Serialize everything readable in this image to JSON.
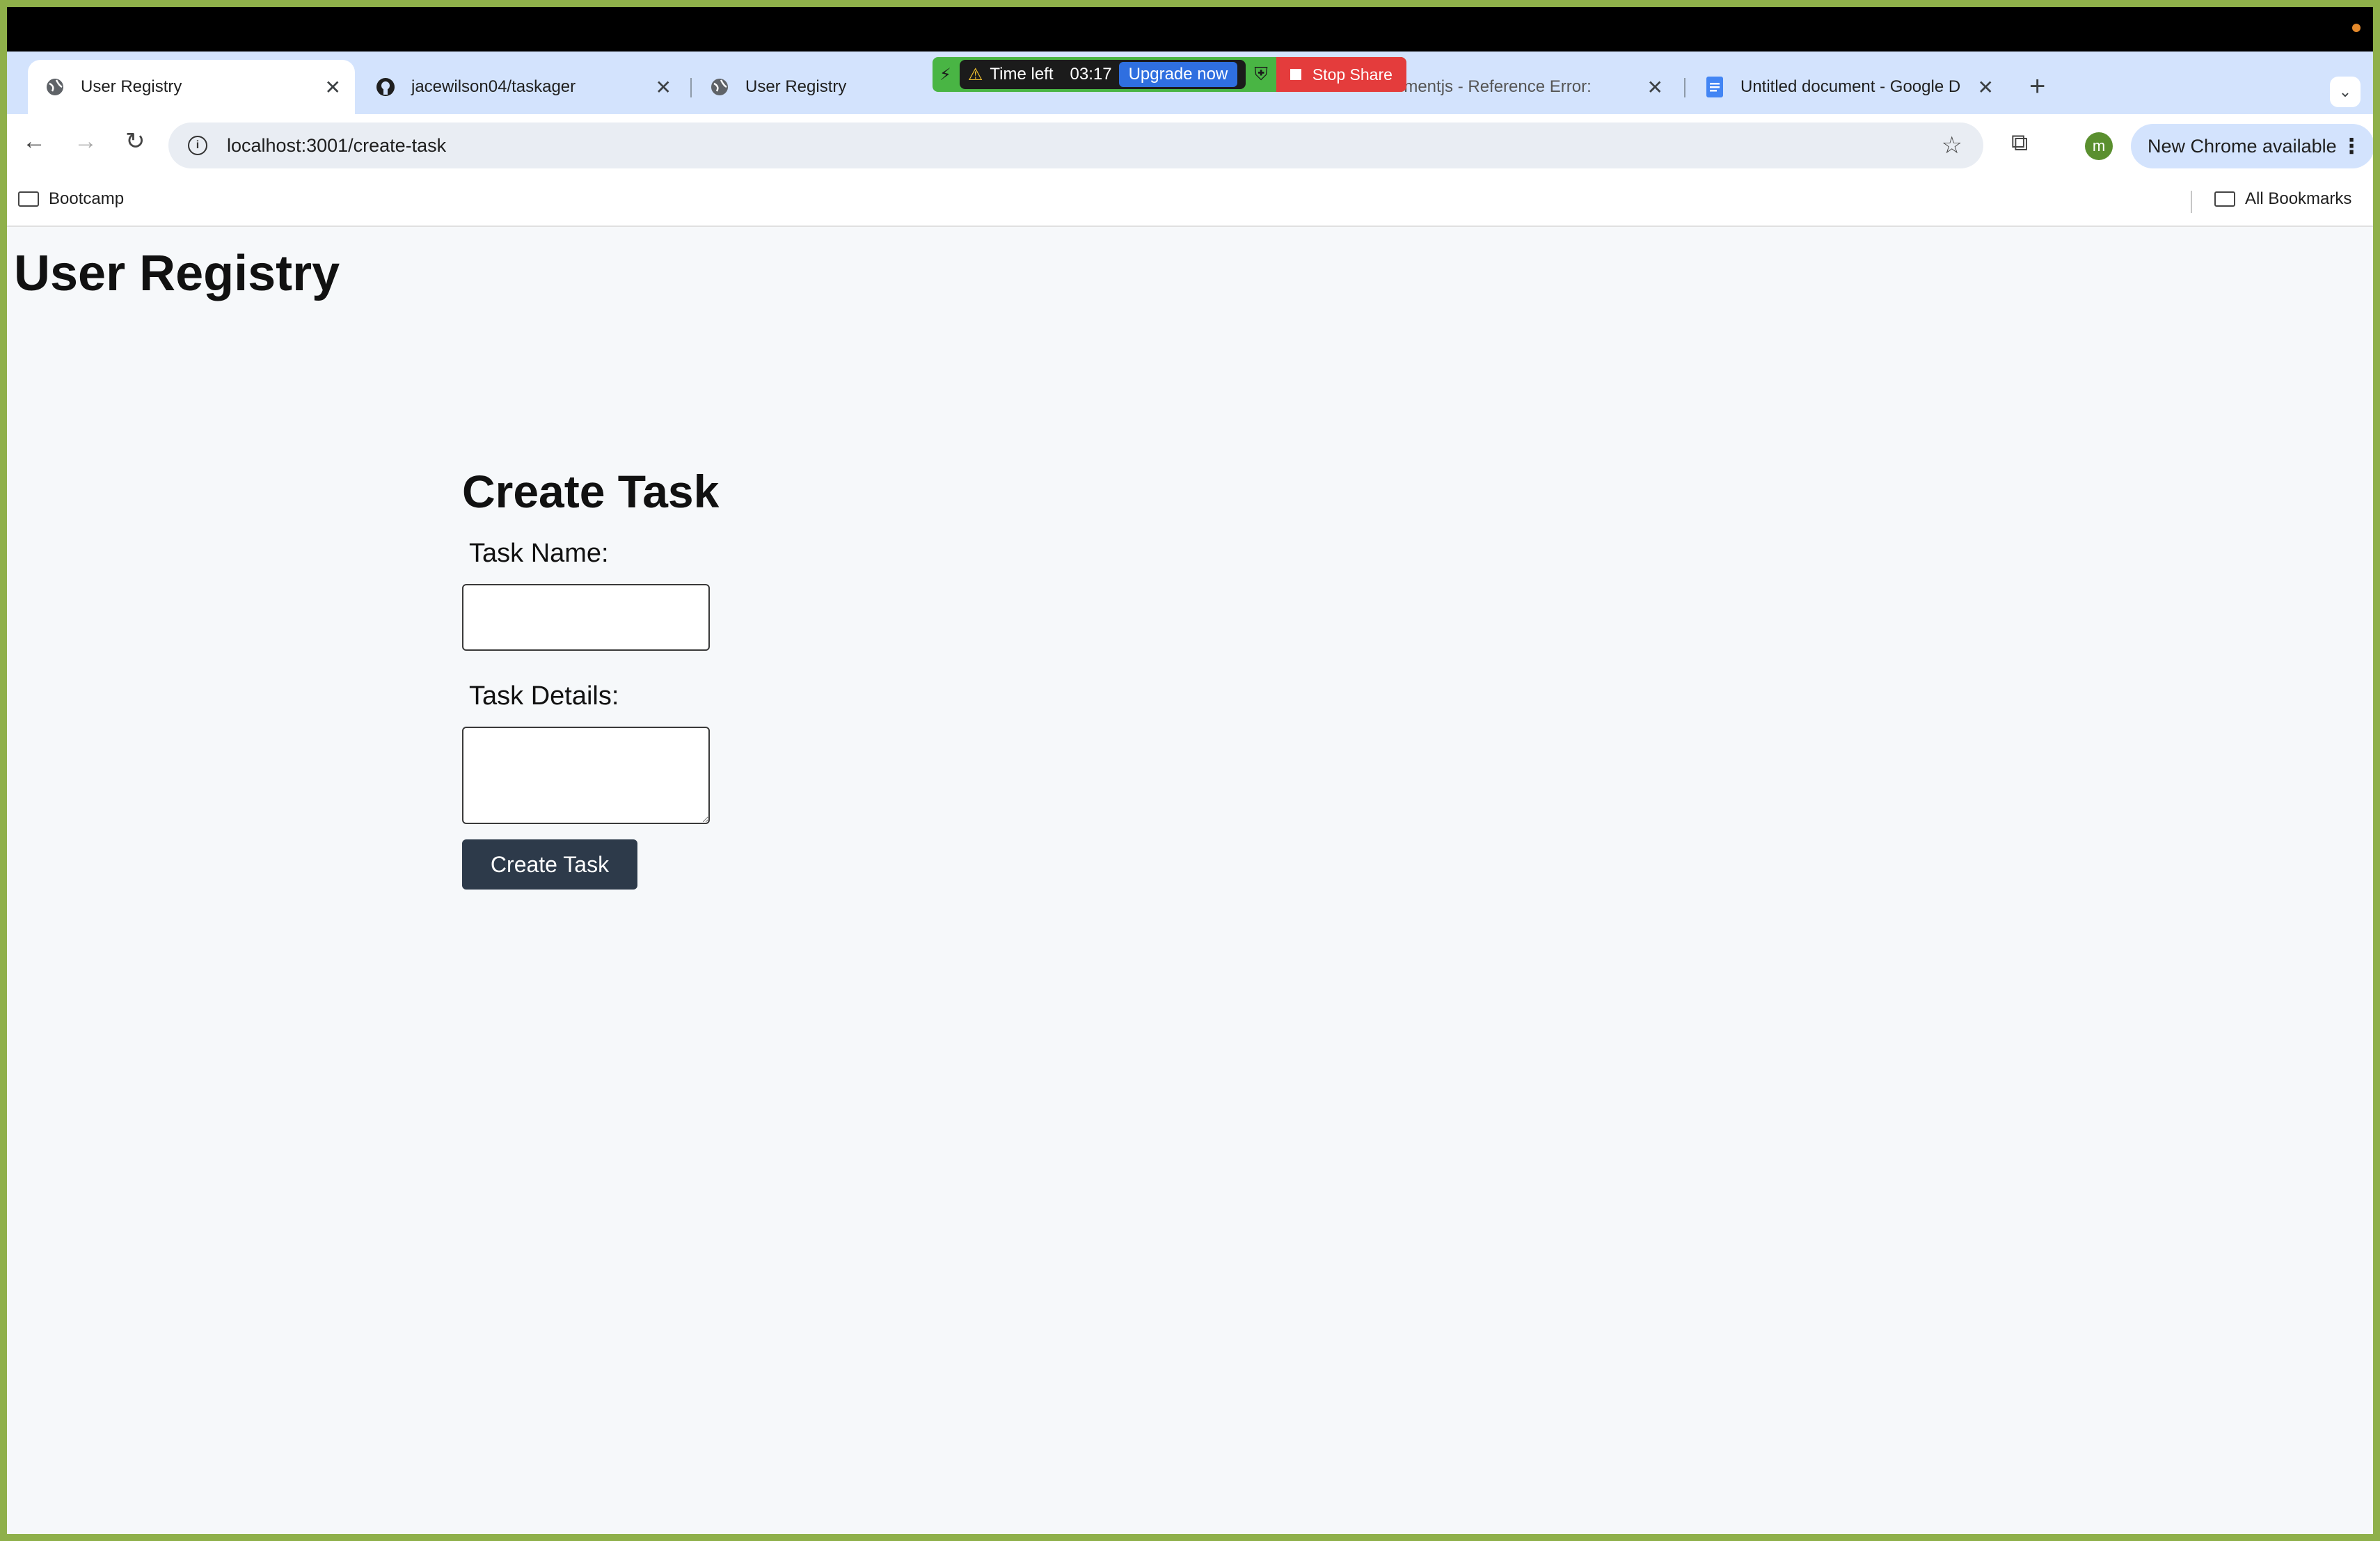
{
  "browser": {
    "tabs": [
      {
        "title": "User Registry",
        "active": true,
        "icon": "globe-icon"
      },
      {
        "title": "jacewilson04/taskager",
        "active": false,
        "icon": "github-icon"
      },
      {
        "title": "User Registry",
        "active": false,
        "icon": "globe-icon"
      },
      {
        "title": "momentjs - Reference Error:",
        "active": false,
        "icon": "doc-icon"
      },
      {
        "title": "Untitled document - Google D",
        "active": false,
        "icon": "google-docs-icon"
      }
    ],
    "url": "localhost:3001/create-task",
    "new_chrome_label": "New Chrome available",
    "avatar_letter": "m",
    "bookmarks": {
      "left": "Bootcamp",
      "right": "All Bookmarks"
    }
  },
  "share_overlay": {
    "time_left_label": "Time left",
    "time_left_value": "03:17",
    "upgrade_label": "Upgrade now",
    "stop_label": "Stop Share"
  },
  "page": {
    "app_title": "User Registry",
    "form": {
      "heading": "Create Task",
      "task_name_label": "Task Name:",
      "task_name_value": "",
      "task_details_label": "Task Details:",
      "task_details_value": "",
      "submit_label": "Create Task"
    }
  },
  "colors": {
    "frame": "#8fb04a",
    "tab_strip": "#d3e3fd",
    "button": "#2d3a4a",
    "stop_share": "#e43c3c",
    "upgrade": "#2f6fe0"
  }
}
